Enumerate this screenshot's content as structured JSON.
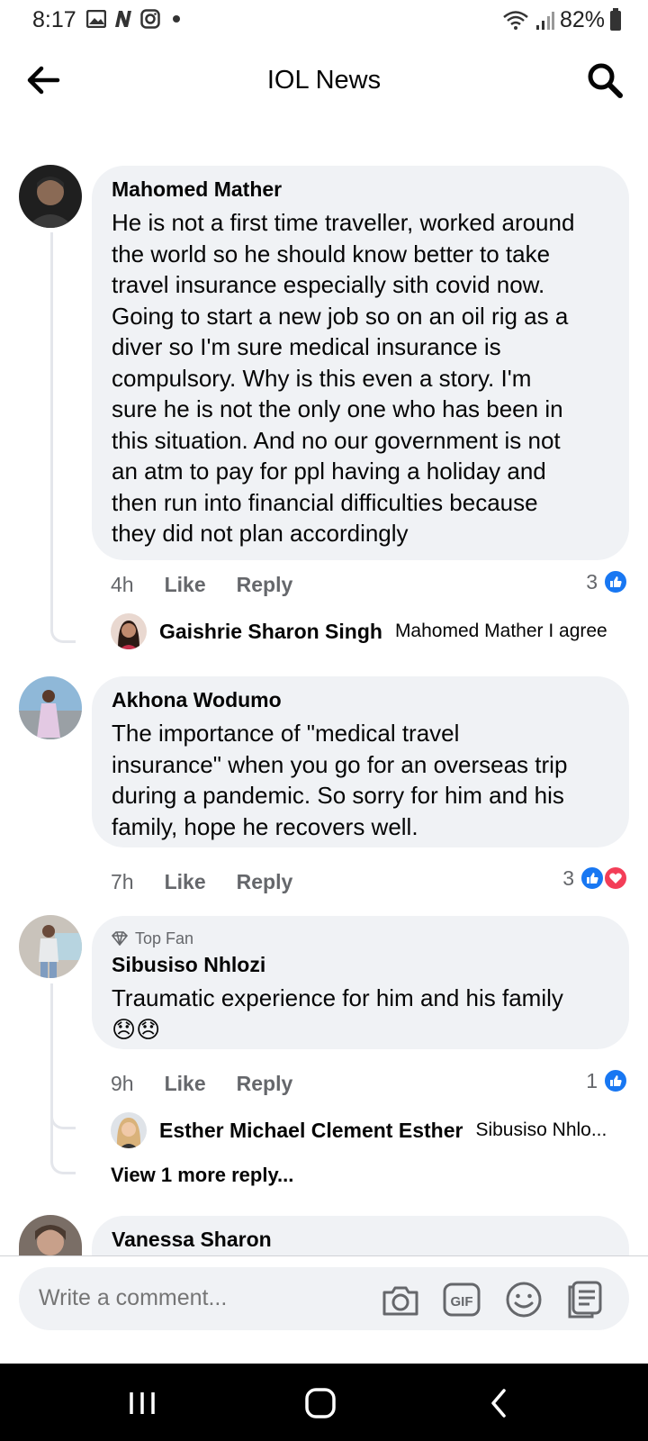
{
  "status_bar": {
    "time": "8:17",
    "battery": "82%"
  },
  "header": {
    "title": "IOL News"
  },
  "comments": [
    {
      "author": "Mahomed Mather",
      "lines": [
        "He is not a first time traveller, worked around",
        "the world so he should know better to take",
        "travel insurance especially sith covid now.",
        "Going to start a new job so on an oil rig as a",
        "diver so I'm sure medical insurance is",
        "compulsory. Why is this even a story.  I'm",
        "sure he is not the only one who has been in",
        "this situation. And no our government is not",
        "an atm to pay for ppl having a holiday and",
        "then run into financial difficulties because",
        "they did not plan accordingly"
      ],
      "time": "4h",
      "like_label": "Like",
      "reply_label": "Reply",
      "reaction_count": "3",
      "reply": {
        "author": "Gaishrie Sharon Singh",
        "text": "Mahomed Mather I agree"
      }
    },
    {
      "author": "Akhona Wodumo",
      "lines": [
        "The importance of \"medical travel",
        "insurance\" when you go for an overseas trip",
        "during a pandemic. So sorry for him and his",
        "family, hope he recovers well."
      ],
      "time": "7h",
      "like_label": "Like",
      "reply_label": "Reply",
      "reaction_count": "3"
    },
    {
      "badge": "Top Fan",
      "author": "Sibusiso Nhlozi",
      "lines": [
        "Traumatic experience for him and his family",
        "😞😞"
      ],
      "time": "9h",
      "like_label": "Like",
      "reply_label": "Reply",
      "reaction_count": "1",
      "reply": {
        "author": "Esther Michael Clement Esther",
        "text": "Sibusiso Nhlo..."
      },
      "more_replies": "View 1 more reply..."
    },
    {
      "author": "Vanessa Sharon"
    }
  ],
  "composer": {
    "placeholder": "Write a comment..."
  },
  "colors": {
    "accent": "#1877f2",
    "heart": "#f33e58",
    "bubble": "#f0f2f5",
    "muted": "#65676b"
  }
}
